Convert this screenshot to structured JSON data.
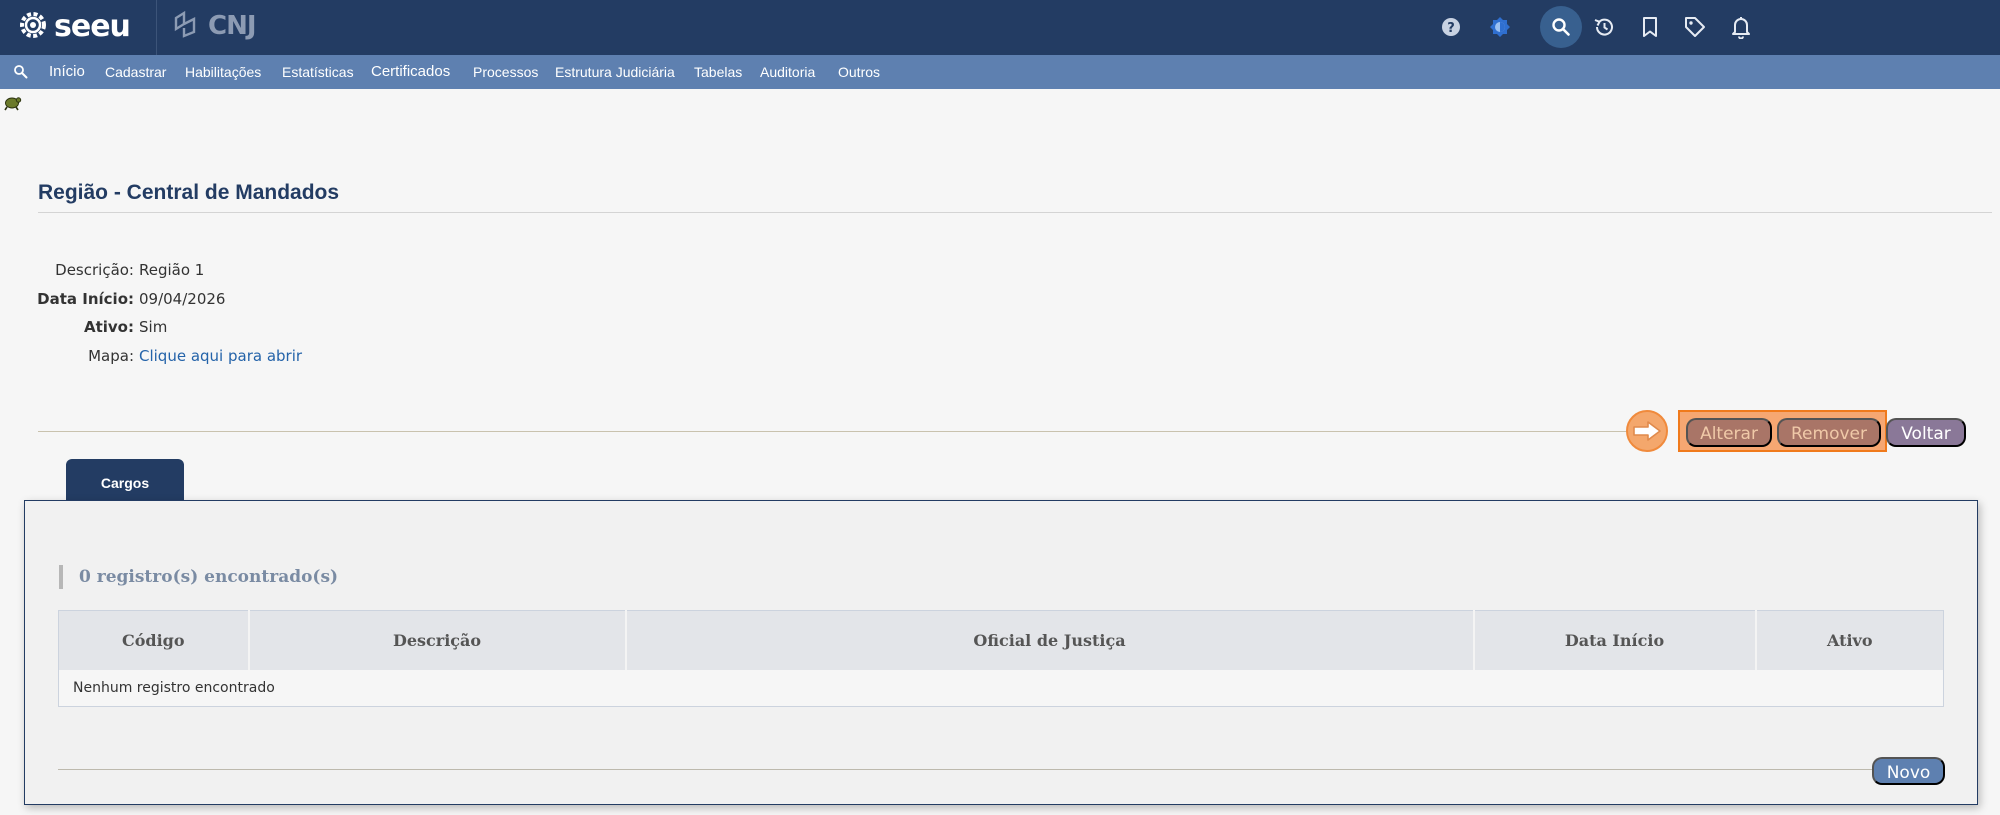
{
  "header": {
    "logo_text": "seeu",
    "partner_logo_text": "CNJ",
    "icons": [
      "help-icon",
      "theme-icon",
      "search-icon",
      "history-icon",
      "bookmark-icon",
      "tag-icon",
      "bell-icon"
    ]
  },
  "menu": {
    "items": [
      {
        "label": "Início"
      },
      {
        "label": "Cadastrar"
      },
      {
        "label": "Habilitações"
      },
      {
        "label": "Estatísticas"
      },
      {
        "label": "Certificados"
      },
      {
        "label": "Processos"
      },
      {
        "label": "Estrutura Judiciária"
      },
      {
        "label": "Tabelas"
      },
      {
        "label": "Auditoria"
      },
      {
        "label": "Outros"
      }
    ]
  },
  "page": {
    "title": "Região - Central de Mandados"
  },
  "details": {
    "descricao_label": "Descrição:",
    "descricao_value": "Região 1",
    "data_inicio_label": "Data Início:",
    "data_inicio_value": "09/04/2026",
    "ativo_label": "Ativo:",
    "ativo_value": "Sim",
    "mapa_label": "Mapa:",
    "mapa_link": "Clique aqui para abrir"
  },
  "actions": {
    "alterar": "Alterar",
    "remover": "Remover",
    "voltar": "Voltar"
  },
  "tabs": [
    {
      "label": "Cargos",
      "active": true
    }
  ],
  "cargos": {
    "count_text": "0 registro(s) encontrado(s)",
    "columns": [
      "Código",
      "Descrição",
      "Oficial de Justiça",
      "Data Início",
      "Ativo"
    ],
    "empty_text": "Nenhum registro encontrado",
    "novo_label": "Novo"
  },
  "colors": {
    "header_bg": "#233c63",
    "menu_bg": "#5e80b0",
    "highlight": "#f07a1c",
    "link": "#2463a9"
  }
}
